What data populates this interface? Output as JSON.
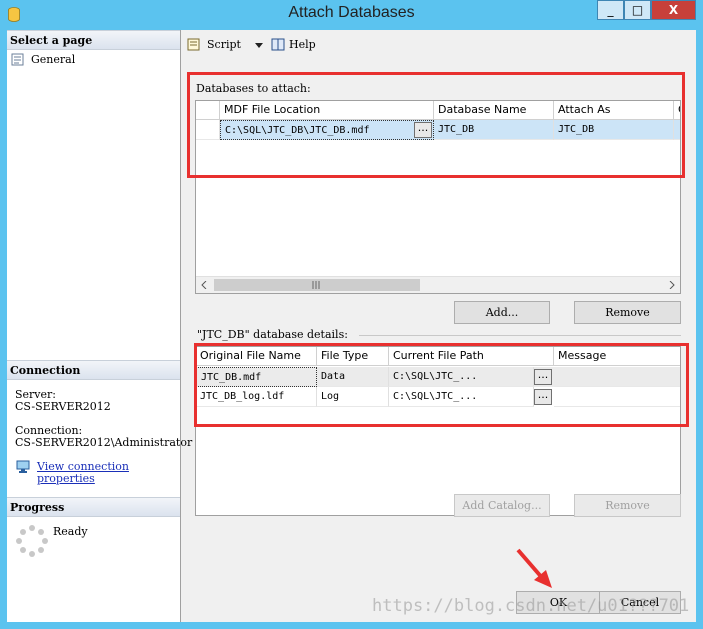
{
  "window": {
    "title": "Attach Databases",
    "minimize": "_",
    "maximize": "□",
    "close": "X"
  },
  "left": {
    "select_page_header": "Select a page",
    "pages": [
      {
        "label": "General",
        "icon": "page-icon"
      }
    ],
    "connection_header": "Connection",
    "server_label": "Server:",
    "server_value": "CS-SERVER2012",
    "connection_label": "Connection:",
    "connection_value": "CS-SERVER2012\\Administrator",
    "view_link_line1": "View connection",
    "view_link_line2": "properties",
    "progress_header": "Progress",
    "progress_status": "Ready"
  },
  "toolbar": {
    "script_label": "Script",
    "help_label": "Help"
  },
  "attach": {
    "group_label": "Databases to attach:",
    "columns": [
      "MDF File Location",
      "Database Name",
      "Attach As",
      "O"
    ],
    "rows": [
      {
        "mdf": "C:\\SQL\\JTC_DB\\JTC_DB.mdf",
        "db_name": "JTC_DB",
        "attach_as": "JTC_DB",
        "extra": "("
      }
    ],
    "browse": "...",
    "add_button": "Add...",
    "remove_button": "Remove"
  },
  "details": {
    "group_label": "\"JTC_DB\" database details:",
    "columns": [
      "Original File Name",
      "File Type",
      "Current File Path",
      "Message"
    ],
    "rows": [
      {
        "name": "JTC_DB.mdf",
        "type": "Data",
        "path": "C:\\SQL\\JTC_...",
        "message": ""
      },
      {
        "name": "JTC_DB_log.ldf",
        "type": "Log",
        "path": "C:\\SQL\\JTC_...",
        "message": ""
      }
    ],
    "browse": "...",
    "add_catalog_button": "Add Catalog...",
    "remove_button": "Remove"
  },
  "footer": {
    "ok": "OK",
    "cancel": "Cancel",
    "watermark": "https://blog.csdn.net/u01???701"
  },
  "colors": {
    "titlebar": "#5bc3ef",
    "highlight": "#e8302f",
    "selected_row": "#cce4f7"
  }
}
